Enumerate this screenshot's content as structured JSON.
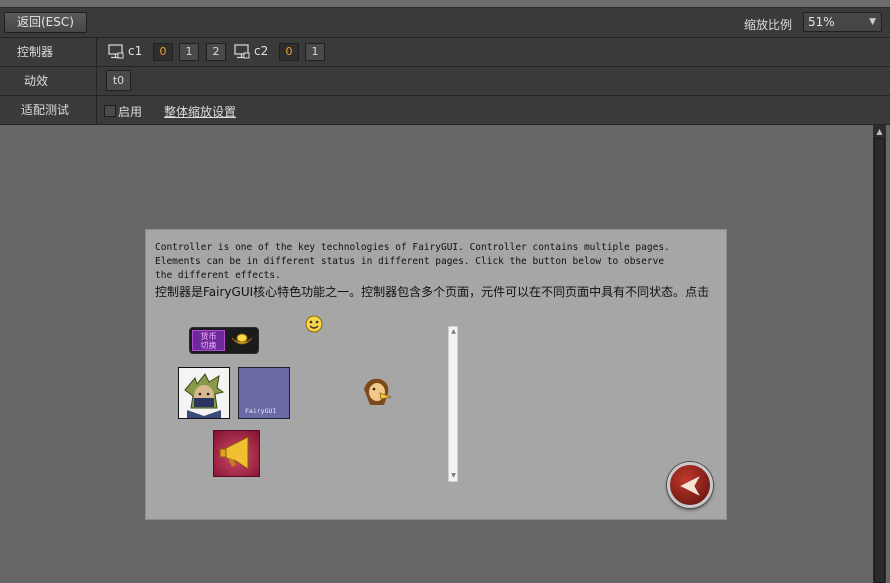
{
  "toolbar": {
    "back_label": "返回(ESC)",
    "zoom_label": "缩放比例",
    "zoom_value": "51%"
  },
  "controllers": {
    "label": "控制器",
    "items": [
      {
        "name": "c1",
        "pages": [
          "0",
          "1",
          "2"
        ],
        "selected": "0"
      },
      {
        "name": "c2",
        "pages": [
          "0",
          "1"
        ],
        "selected": "0"
      }
    ]
  },
  "transitions": {
    "label": "动效",
    "items": [
      "t0"
    ]
  },
  "adapt_test": {
    "label": "适配测试",
    "enable_label": "启用",
    "enabled": false,
    "scale_settings_link": "整体缩放设置"
  },
  "stage": {
    "text_en": "Controller is one of the key technologies of FairyGUI. Controller contains multiple pages.\nElements can be in different status in different pages. Click the button below to observe\nthe different effects.",
    "text_zh": "控制器是FairyGUI核心特色功能之一。控制器包含多个页面，元件可以在不同页面中具有不同状态。点击",
    "currency_tag": "货币\n切换",
    "fairy_tile_text": "FairyGUI"
  },
  "colors": {
    "panel_bg": "#3a3a3a",
    "canvas_bg": "#666666",
    "stage_bg": "#a6a6a6",
    "active_page": "#f0a030"
  }
}
